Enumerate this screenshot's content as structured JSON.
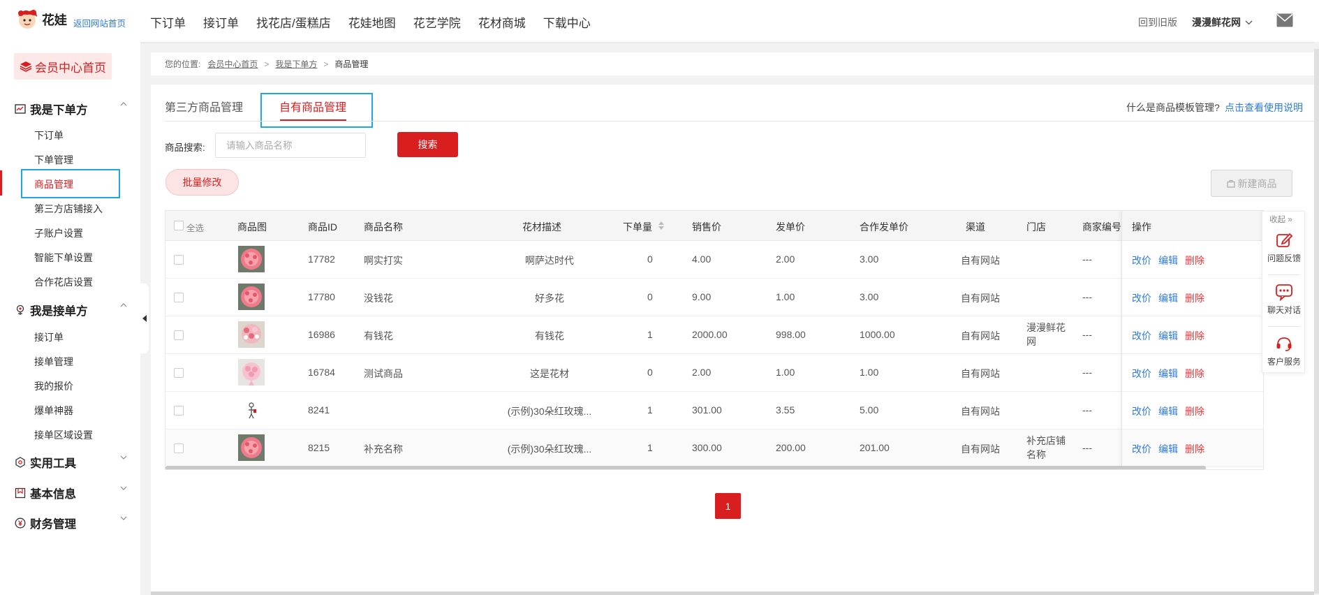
{
  "header": {
    "logo_text": "花娃",
    "back_link": "返回网站首页",
    "nav": [
      "下订单",
      "接订单",
      "找花店/蛋糕店",
      "花娃地图",
      "花艺学院",
      "花材商城",
      "下载中心"
    ],
    "old_version": "回到旧版",
    "user_name": "漫漫鲜花网"
  },
  "sidebar": {
    "home": "会员中心首页",
    "sections": [
      {
        "label": "我是下单方",
        "items": [
          "下订单",
          "下单管理",
          "商品管理",
          "第三方店铺接入",
          "子账户设置",
          "智能下单设置",
          "合作花店设置"
        ]
      },
      {
        "label": "我是接单方",
        "items": [
          "接订单",
          "接单管理",
          "我的报价",
          "爆单神器",
          "接单区域设置"
        ]
      },
      {
        "label": "实用工具"
      },
      {
        "label": "基本信息"
      },
      {
        "label": "财务管理"
      }
    ],
    "active_item": "商品管理"
  },
  "breadcrumb": {
    "prefix": "您的位置:",
    "links": [
      "会员中心首页",
      "我是下单方"
    ],
    "current": "商品管理"
  },
  "tabs": {
    "tab1": "第三方商品管理",
    "tab2": "自有商品管理",
    "help_question": "什么是商品模板管理?",
    "help_link": "点击查看使用说明"
  },
  "search": {
    "label": "商品搜索:",
    "placeholder": "请输入商品名称",
    "button": "搜索"
  },
  "actions": {
    "batch_edit": "批量修改",
    "new_product": "新建商品"
  },
  "table": {
    "headers": {
      "select_all": "全选",
      "image": "商品图",
      "id": "商品ID",
      "name": "商品名称",
      "desc": "花材描述",
      "order_qty": "下单量",
      "sale_price": "销售价",
      "send_price": "发单价",
      "coop_price": "合作发单价",
      "channel": "渠道",
      "store": "门店",
      "merchant_no": "商家编号",
      "ops": "操作"
    },
    "ops_labels": {
      "price": "改价",
      "edit": "编辑",
      "delete": "删除"
    },
    "rows": [
      {
        "id": "17782",
        "name": "啊实打实",
        "desc": "啊萨达时代",
        "qty": "0",
        "sale": "4.00",
        "send": "2.00",
        "coop": "3.00",
        "channel": "自有网站",
        "store": "",
        "merchant": "---",
        "thumb": "pink-rose-bouquet"
      },
      {
        "id": "17780",
        "name": "没钱花",
        "desc": "好多花",
        "qty": "0",
        "sale": "9.00",
        "send": "1.00",
        "coop": "3.00",
        "channel": "自有网站",
        "store": "",
        "merchant": "---",
        "thumb": "pink-rose-bouquet"
      },
      {
        "id": "16986",
        "name": "有钱花",
        "desc": "有钱花",
        "qty": "1",
        "sale": "2000.00",
        "send": "998.00",
        "coop": "1000.00",
        "channel": "自有网站",
        "store": "漫漫鲜花网",
        "merchant": "---",
        "thumb": "mixed-bouquet"
      },
      {
        "id": "16784",
        "name": "测试商品",
        "desc": "这是花材",
        "qty": "0",
        "sale": "2.00",
        "send": "1.00",
        "coop": "1.00",
        "channel": "自有网站",
        "store": "",
        "merchant": "---",
        "thumb": "light-pink-bouquet"
      },
      {
        "id": "8241",
        "name": "",
        "desc": "(示例)30朵红玫瑰...",
        "qty": "1",
        "sale": "301.00",
        "send": "3.55",
        "coop": "5.00",
        "channel": "自有网站",
        "store": "",
        "merchant": "---",
        "thumb": "stick-figure"
      },
      {
        "id": "8215",
        "name": "补充名称",
        "desc": "(示例)30朵红玫瑰...",
        "qty": "1",
        "sale": "300.00",
        "send": "200.00",
        "coop": "201.00",
        "channel": "自有网站",
        "store": "补充店铺名称",
        "merchant": "---",
        "thumb": "pink-rose-bouquet"
      }
    ]
  },
  "pagination": {
    "current": "1"
  },
  "float_panel": {
    "fold": "收起",
    "items": [
      {
        "label": "问题反馈",
        "icon": "edit-icon"
      },
      {
        "label": "聊天对话",
        "icon": "chat-icon"
      },
      {
        "label": "客户服务",
        "icon": "headset-icon"
      }
    ]
  },
  "colors": {
    "brand_red": "#d81e1e",
    "link_blue": "#2f7bd8",
    "highlight_box": "#1ea6e8"
  }
}
